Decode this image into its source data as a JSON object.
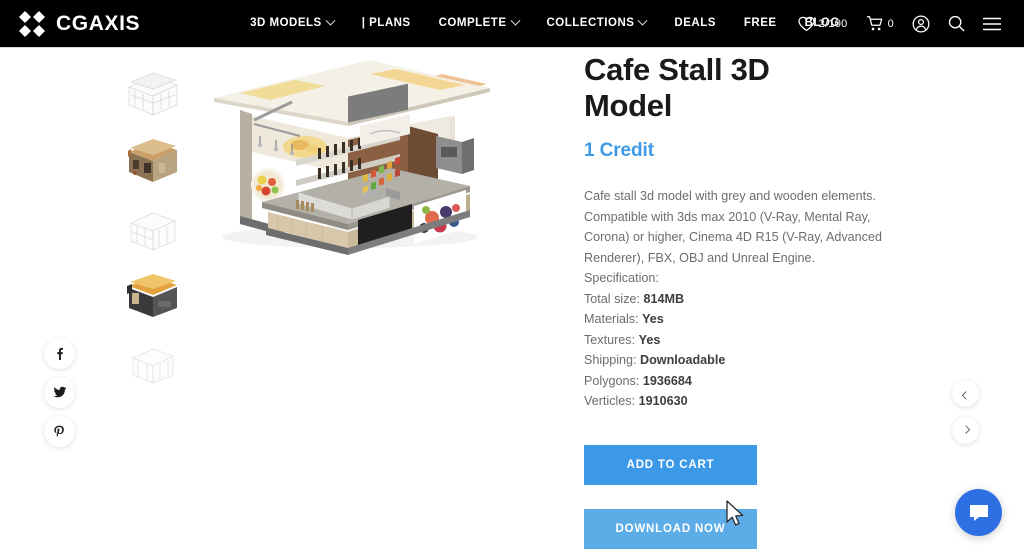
{
  "header": {
    "logo_text": "CGAXIS",
    "nav": [
      {
        "label": "3D MODELS",
        "has_caret": true
      },
      {
        "label": "| PLANS",
        "has_caret": false
      },
      {
        "label": "COMPLETE",
        "has_caret": true
      },
      {
        "label": "COLLECTIONS",
        "has_caret": true
      },
      {
        "label": "DEALS",
        "has_caret": false
      },
      {
        "label": "FREE",
        "has_caret": false
      },
      {
        "label": "BLOG",
        "has_caret": false
      }
    ],
    "wishlist_count": "2/100",
    "cart_count": "0"
  },
  "gallery": {
    "thumbnails": [
      {
        "name": "thumbnail-1-wireframe"
      },
      {
        "name": "thumbnail-2-render"
      },
      {
        "name": "thumbnail-3-clay"
      },
      {
        "name": "thumbnail-4-render"
      },
      {
        "name": "thumbnail-5-wireframe"
      }
    ]
  },
  "social": {
    "facebook_label": "f",
    "twitter_label": "t",
    "pinterest_label": "P"
  },
  "product": {
    "title": "Cafe Stall 3D Model",
    "price": "1 Credit",
    "description": "Cafe stall 3d model with grey and wooden elements. Compatible with 3ds max 2010 (V-Ray, Mental Ray, Corona) or higher, Cinema 4D R15 (V-Ray, Advanced Renderer), FBX, OBJ and Unreal Engine.",
    "spec_heading": "Specification:",
    "specs": [
      {
        "label": "Total size:",
        "value": "814MB"
      },
      {
        "label": "Materials:",
        "value": "Yes"
      },
      {
        "label": "Textures:",
        "value": "Yes"
      },
      {
        "label": "Shipping:",
        "value": "Downloadable"
      },
      {
        "label": "Polygons:",
        "value": "1936684"
      },
      {
        "label": "Verticles:",
        "value": "1910630"
      }
    ],
    "add_to_cart_label": "ADD TO CART",
    "download_label": "DOWNLOAD NOW"
  },
  "colors": {
    "accent_blue": "#3b99e8",
    "accent_blue_hover": "#5cace8",
    "price_blue": "#3e9ae4",
    "chat_blue": "#2f6fe4",
    "header_black": "#000000",
    "body_text": "#6d6d6d"
  }
}
